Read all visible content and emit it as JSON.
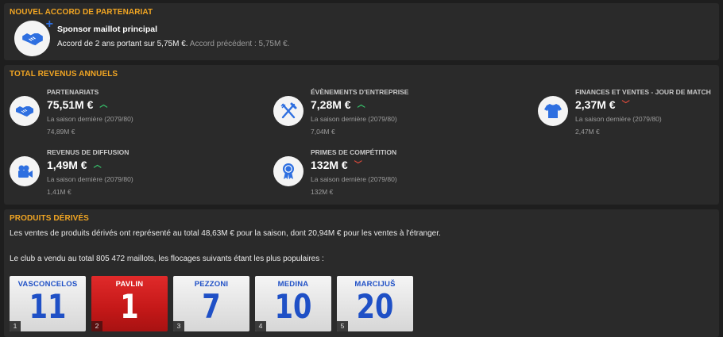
{
  "colors": {
    "accent": "#f2a623",
    "icon_blue": "#2e6fe0",
    "up": "#37c76d",
    "down": "#e14b3c"
  },
  "partnership": {
    "title": "NOUVEL ACCORD DE PARTENARIAT",
    "icon": "handshake-icon",
    "sponsor_title": "Sponsor maillot principal",
    "deal_text": "Accord de 2 ans portant sur 5,75M €.",
    "previous_text": "Accord précédent : 5,75M €."
  },
  "revenues": {
    "title": "TOTAL REVENUS ANNUELS",
    "items": [
      {
        "label": "PARTENARIATS",
        "value": "75,51M €",
        "trend": "up",
        "trend_glyph": "︿",
        "sub": "La saison dernière (2079/80)",
        "prev": "74,89M €",
        "icon": "handshake-icon"
      },
      {
        "label": "ÉVÈNEMENTS D'ENTREPRISE",
        "value": "7,28M €",
        "trend": "up",
        "trend_glyph": "︿",
        "sub": "La saison dernière (2079/80)",
        "prev": "7,04M €",
        "icon": "cutlery-icon"
      },
      {
        "label": "FINANCES ET VENTES - JOUR DE MATCH",
        "value": "2,37M €",
        "trend": "down",
        "trend_glyph": "﹀",
        "sub": "La saison dernière (2079/80)",
        "prev": "2,47M €",
        "icon": "shirt-icon"
      },
      {
        "label": "REVENUS DE DIFFUSION",
        "value": "1,49M €",
        "trend": "up",
        "trend_glyph": "︿",
        "sub": "La saison dernière (2079/80)",
        "prev": "1,41M €",
        "icon": "camera-icon"
      },
      {
        "label": "PRIMES DE COMPÉTITION",
        "value": "132M €",
        "trend": "down",
        "trend_glyph": "﹀",
        "sub": "La saison dernière (2079/80)",
        "prev": "132M €",
        "icon": "medal-icon"
      }
    ]
  },
  "merchandise": {
    "title": "PRODUITS DÉRIVÉS",
    "text1": "Les ventes de produits dérivés ont représenté au total 48,63M € pour la saison, dont 20,94M € pour les ventes à l'étranger.",
    "text2": "Le club a vendu au total 805 472 maillots, les flocages suivants étant les plus populaires :",
    "shirts": [
      {
        "rank": "1",
        "name": "VASCONCELOS",
        "number": "11",
        "style": "white"
      },
      {
        "rank": "2",
        "name": "PAVLIN",
        "number": "1",
        "style": "red"
      },
      {
        "rank": "3",
        "name": "PEZZONI",
        "number": "7",
        "style": "white"
      },
      {
        "rank": "4",
        "name": "MEDINA",
        "number": "10",
        "style": "white"
      },
      {
        "rank": "5",
        "name": "MARCIJUŠ",
        "number": "20",
        "style": "white"
      }
    ]
  }
}
